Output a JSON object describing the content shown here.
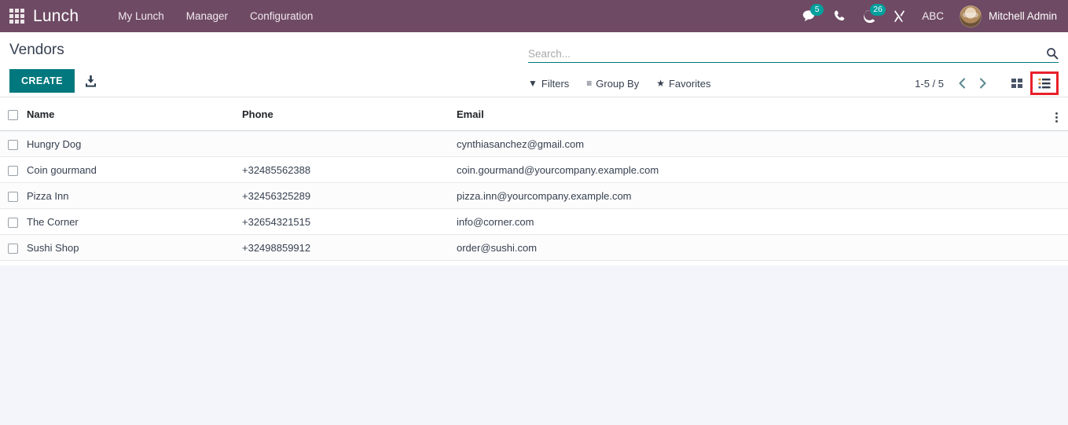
{
  "navbar": {
    "apps_icon": "apps-grid-icon",
    "brand": "Lunch",
    "menus": [
      {
        "label": "My Lunch"
      },
      {
        "label": "Manager"
      },
      {
        "label": "Configuration"
      }
    ],
    "sys_icons": [
      {
        "name": "messaging-icon",
        "badge": "5"
      },
      {
        "name": "phone-icon",
        "badge": ""
      },
      {
        "name": "activity-clock-icon",
        "badge": "26"
      },
      {
        "name": "tools-icon",
        "badge": ""
      }
    ],
    "debug_label": "ABC",
    "user_name": "Mitchell Admin",
    "accent_color": "#6F4A64",
    "badge_color": "#00A09D"
  },
  "control_panel": {
    "title": "Vendors",
    "create_label": "CREATE",
    "create_color": "#00787E",
    "import_icon": "import-download-icon",
    "search": {
      "placeholder": "Search...",
      "value": "",
      "icon": "search-icon"
    },
    "filters": [
      {
        "name": "filters",
        "glyph": "▼",
        "label": "Filters"
      },
      {
        "name": "group-by",
        "glyph": "≡",
        "label": "Group By"
      },
      {
        "name": "favorites",
        "glyph": "★",
        "label": "Favorites"
      }
    ],
    "pager": {
      "count": "1-5 / 5",
      "prev_icon": "chevron-left-icon",
      "next_icon": "chevron-right-icon"
    },
    "views": [
      {
        "name": "kanban-view-button",
        "icon": "kanban-grid-icon",
        "active": false,
        "highlighted": false
      },
      {
        "name": "list-view-button",
        "icon": "list-view-icon",
        "active": true,
        "highlighted": true
      }
    ],
    "highlight_color": "#E8202A"
  },
  "table": {
    "columns": [
      {
        "key": "name",
        "label": "Name"
      },
      {
        "key": "phone",
        "label": "Phone"
      },
      {
        "key": "email",
        "label": "Email"
      }
    ],
    "optional_columns_icon": "kebab-menu-icon",
    "rows": [
      {
        "name": "Hungry Dog",
        "phone": "",
        "email": "cynthiasanchez@gmail.com"
      },
      {
        "name": "Coin gourmand",
        "phone": "+32485562388",
        "email": "coin.gourmand@yourcompany.example.com"
      },
      {
        "name": "Pizza Inn",
        "phone": "+32456325289",
        "email": "pizza.inn@yourcompany.example.com"
      },
      {
        "name": "The Corner",
        "phone": "+32654321515",
        "email": "info@corner.com"
      },
      {
        "name": "Sushi Shop",
        "phone": "+32498859912",
        "email": "order@sushi.com"
      }
    ]
  }
}
